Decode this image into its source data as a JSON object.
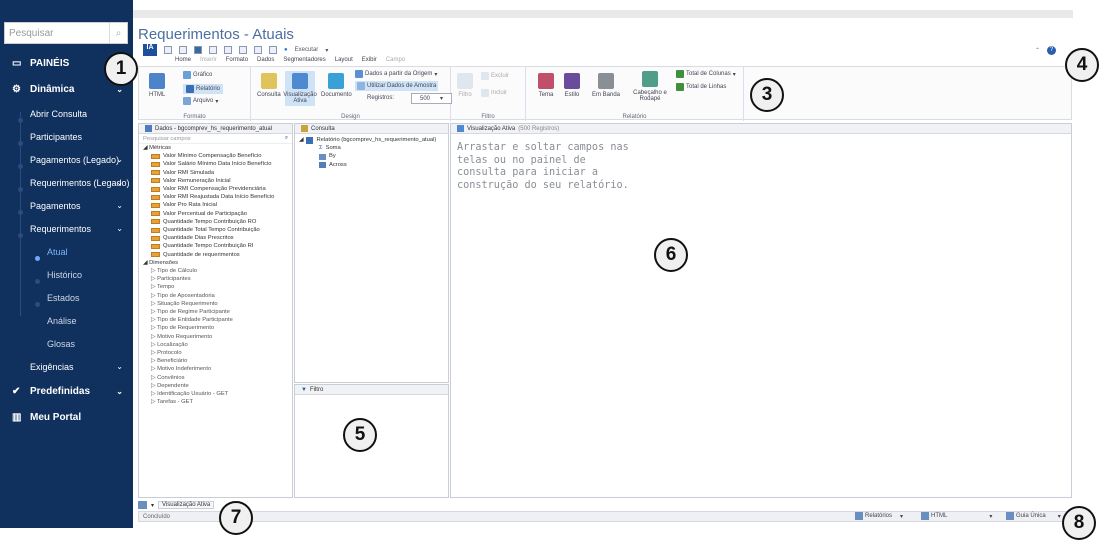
{
  "sidebar": {
    "search_placeholder": "Pesquisar",
    "items": [
      {
        "label": "PAINÉIS",
        "icon": "monitor-icon"
      },
      {
        "label": "Dinâmica",
        "icon": "sitemap-icon"
      },
      {
        "label": "Abrir Consulta"
      },
      {
        "label": "Participantes"
      },
      {
        "label": "Pagamentos (Legado)"
      },
      {
        "label": "Requerimentos (Legado)"
      },
      {
        "label": "Pagamentos"
      },
      {
        "label": "Requerimentos"
      },
      {
        "label": "Atual"
      },
      {
        "label": "Histórico"
      },
      {
        "label": "Estados"
      },
      {
        "label": "Análise"
      },
      {
        "label": "Glosas"
      },
      {
        "label": "Exigências"
      },
      {
        "label": "Predefinidas",
        "icon": "check-icon"
      },
      {
        "label": "Meu Portal",
        "icon": "chart-icon"
      }
    ]
  },
  "page": {
    "title": "Requerimentos - Atuais"
  },
  "toolbar": {
    "executar": "Executar"
  },
  "menus": [
    "Home",
    "Inserir",
    "Formato",
    "Dados",
    "Segmentadores",
    "Layout",
    "Exibir",
    "Campo"
  ],
  "ribbon": {
    "html": "HTML",
    "grafico": "Gráfico",
    "relatorio": "Relatório",
    "arquivo": "Arquivo",
    "consulta": "Consulta",
    "visualizacao_ativa": "Visualização Ativa",
    "documento": "Documento",
    "dados_origem": "Dados a partir da Origem",
    "dados_amostra": "Utilizar Dados de Amostra",
    "registros_label": "Registros:",
    "registros_value": "500",
    "filtro": "Filtro",
    "excluir": "Excluir",
    "incluir": "Incluir",
    "tema": "Tema",
    "estilo": "Estilo",
    "em_banda": "Em Banda",
    "cabecalho": "Cabeçalho e Rodapé",
    "total_colunas": "Total de Colunas",
    "total_linhas": "Total de Linhas",
    "group_formato": "Formato",
    "group_design": "Design",
    "group_filtro": "Filtro",
    "group_relatorio": "Relatório"
  },
  "data_pane": {
    "title": "Dados - bgcomprev_hs_requerimento_atual",
    "search_placeholder": "Pesquisar campos",
    "metricas_label": "Métricas",
    "metricas": [
      "Valor Mínimo Compensação Benefício",
      "Valor Salário Mínimo Data Início Benefício",
      "Valor RMI Simulada",
      "Valor Remuneração Inicial",
      "Valor RMI Compensação Previdenciária",
      "Valor RMI Reajustada Data Início Benefício",
      "Valor Pro Rata Inicial",
      "Valor Percentual de Participação",
      "Quantidade Tempo Contribuição RO",
      "Quantidade Total Tempo Contribuição",
      "Quantidade Dias Prescritos",
      "Quantidade Tempo Contribuição RI",
      "Quantidade de requerimentos"
    ],
    "dimensoes_label": "Dimensões",
    "dimensoes": [
      "Tipo de Cálculo",
      "Participantes",
      "Tempo",
      "Tipo de Aposentadoria",
      "Situação Requerimento",
      "Tipo de Regime Participante",
      "Tipo de Entidade Participante",
      "Tipo de Requerimento",
      "Motivo Requerimento",
      "Localização",
      "Protocolo",
      "Beneficiário",
      "Motivo Indeferimento",
      "Convênios",
      "Dependente",
      "Identificação Usuário - GET",
      "Tarefas - GET"
    ]
  },
  "consulta_pane": {
    "title": "Consulta",
    "root": "Relatório (bgcomprev_hs_requerimento_atual)",
    "children": [
      "Soma",
      "By",
      "Across"
    ]
  },
  "filtro_pane": {
    "title": "Filtro"
  },
  "view_pane": {
    "title": "Visualização Ativa",
    "records": "(500 Registros)",
    "hint": "Arrastar e soltar campos nas telas ou no painel de consulta para iniciar a construção do seu relatório."
  },
  "bottom": {
    "tab": "Visualização Ativa",
    "status": "Concluído",
    "relatorios": "Relatórios",
    "html": "HTML",
    "guia": "Guia Única"
  },
  "callouts": [
    "1",
    "2",
    "3",
    "4",
    "5",
    "6",
    "7",
    "8"
  ],
  "colors": {
    "sidebar": "#10305e",
    "title": "#4c6f9e",
    "accent": "#1e4f9a"
  }
}
